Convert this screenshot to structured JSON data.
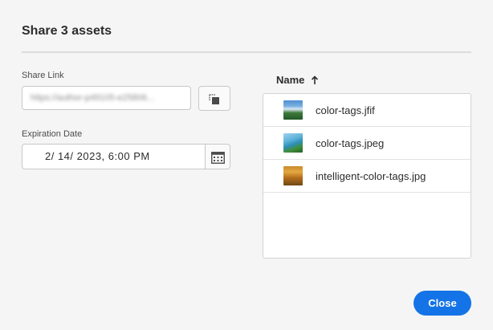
{
  "dialog": {
    "title": "Share 3 assets"
  },
  "share_link": {
    "label": "Share Link",
    "value": "https://author-p49105-e25806..."
  },
  "expiration": {
    "label": "Expiration Date",
    "value": "2/ 14/ 2023,  6:00  PM"
  },
  "file_list": {
    "header": "Name",
    "sort_icon": "arrow-up-icon",
    "files": [
      {
        "name": "color-tags.jfif"
      },
      {
        "name": "color-tags.jpeg"
      },
      {
        "name": "intelligent-color-tags.jpg"
      }
    ]
  },
  "actions": {
    "close_label": "Close"
  },
  "colors": {
    "accent": "#1473e6",
    "background": "#f5f5f5"
  }
}
